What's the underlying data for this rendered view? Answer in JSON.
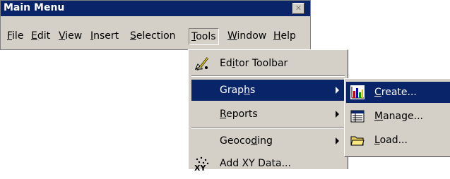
{
  "window": {
    "title": "Main Menu",
    "close_glyph": "✕"
  },
  "menubar": {
    "items": [
      {
        "pre": "",
        "key": "F",
        "post": "ile"
      },
      {
        "pre": "",
        "key": "E",
        "post": "dit"
      },
      {
        "pre": "",
        "key": "V",
        "post": "iew"
      },
      {
        "pre": "",
        "key": "I",
        "post": "nsert"
      },
      {
        "pre": "",
        "key": "S",
        "post": "election"
      },
      {
        "pre": "",
        "key": "T",
        "post": "ools"
      },
      {
        "pre": "",
        "key": "W",
        "post": "indow"
      },
      {
        "pre": "",
        "key": "H",
        "post": "elp"
      }
    ]
  },
  "tools_menu": {
    "items": [
      {
        "pre": "Ed",
        "key": "i",
        "post": "tor Toolbar",
        "icon": "editor-toolbar-icon"
      },
      {
        "pre": "Grap",
        "key": "h",
        "post": "s",
        "submenu": true,
        "highlighted": true
      },
      {
        "pre": "",
        "key": "R",
        "post": "eports",
        "submenu": true
      },
      {
        "pre": "Geoco",
        "key": "d",
        "post": "ing",
        "submenu": true
      },
      {
        "pre": "Add XY Data...",
        "key": "",
        "post": "",
        "icon": "add-xy-data-icon"
      }
    ]
  },
  "graphs_menu": {
    "items": [
      {
        "pre": "",
        "key": "C",
        "post": "reate...",
        "icon": "create-graph-icon",
        "highlighted": true
      },
      {
        "pre": "",
        "key": "M",
        "post": "anage...",
        "icon": "manage-graphs-icon"
      },
      {
        "pre": "",
        "key": "L",
        "post": "oad...",
        "icon": "load-graph-icon"
      }
    ]
  },
  "colors": {
    "highlight": "#0a246a",
    "face": "#d4d0c8",
    "highlight_text": "#ffffff"
  }
}
